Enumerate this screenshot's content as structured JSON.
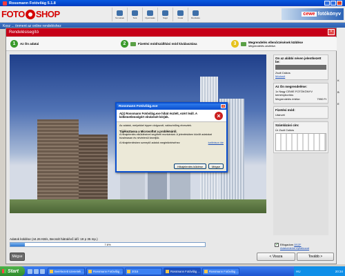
{
  "app": {
    "title": "Rossmann Fotóvilág 5.1.8",
    "sub_title": "Kosz ... önment az online rendeléshez",
    "logo_part1": "FOTO",
    "logo_part2": "SHOP",
    "cewe_brand": "cewe",
    "cewe_text": "fotókönyv",
    "toolbar": [
      "Termékek",
      "Teré",
      "Nyomtatás",
      "Súgó",
      "Kosár",
      "Rendelés"
    ]
  },
  "wizard": {
    "title": "Rendelésisegító",
    "close": "×",
    "steps": [
      {
        "num": "1",
        "label": "Az Ön adatai",
        "sub": ""
      },
      {
        "num": "2",
        "label": "Fizetési mód/szállítási mód kiválasztása",
        "sub": ""
      },
      {
        "num": "3",
        "label": "Megrendelés ellenőrzésének küldése",
        "sub": "Megrendelés átvitelse."
      }
    ],
    "progress_text": "Adatok küldése (44.26 KB/s, Becsült hátralévő idő: 19 p 35 mp.)",
    "progress_label": "7.6%",
    "progress_value": 7.6,
    "buttons": {
      "cancel": "Mégse",
      "back": "< Vissza",
      "next": "Tovább >"
    }
  },
  "right_panel": {
    "sender_heading": "On az alábbi néven jelentkezett be:",
    "user_name": "Zsolt Csikós",
    "change_link": "Módosít",
    "order_heading": "Az Ön megrendelése:",
    "order_item": "1x Nagy CEWE FOTÓKÖNYV keményborítós",
    "order_total_label": "Megrendelés értéke:",
    "order_total": "7990 Ft",
    "payment_heading": "Fizetési mód:",
    "payment_value": "Utánvét",
    "billing_heading": "Számlázási cím:",
    "billing_value": "Úr Zsolt Csikós",
    "terms_text": "Elfogadom",
    "terms_link": "ÁSZF",
    "terms_sub": "Adatvédelmi nyilatkozat"
  },
  "error_dialog": {
    "title": "Rossmann Fotóvilág.exe",
    "close": "×",
    "heading": "A(z) Rossmann Fotóvilág.exe hibát észlelt, ezért leáll. A kellemetlenségért elnézését kérjük.",
    "line1": "Az adatok, melyekkel éppen dolgozott, valószínűleg elvesztek.",
    "bold": "Tájékoztassa a Microsoftot a problémáról.",
    "line2": "A hibajelentés elküldésével segítheti munkánkat. A jelentéskben közölt adatokat bizalmasan és névtelenül kezeljük.",
    "line3": "A hibajelentésben szereplő adatok megtekintéséhez",
    "link": "kattintson ide",
    "send_btn": "Hibajelentés küldése",
    "cancel_btn": "Mégse",
    "error_icon": "×"
  },
  "side_edge": [
    "K",
    "B",
    "E"
  ],
  "taskbar": {
    "start": "Start",
    "tasks": [
      "Beérkezett üzenetek ...",
      "Rossmann Fotóvilág ...",
      "2015",
      "Rossmann Fotóvilág ...",
      "Rossmann Fotóvilág ..."
    ],
    "lang": "HU",
    "clock": "20:34"
  }
}
